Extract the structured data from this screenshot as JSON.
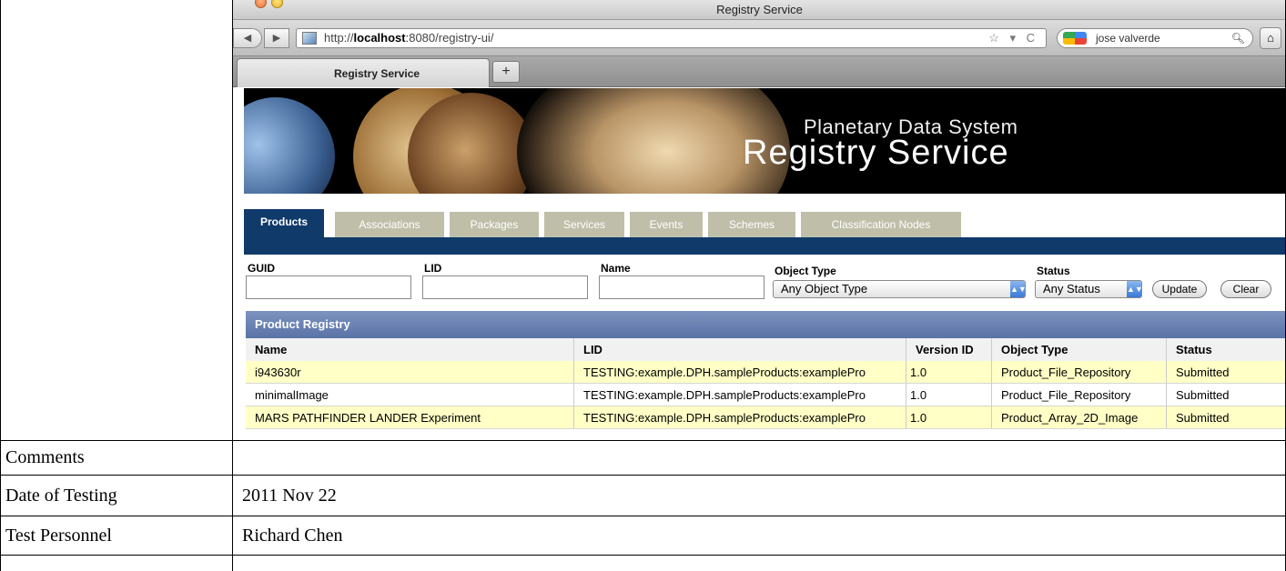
{
  "browser": {
    "window_title": "Registry Service",
    "url_prefix": "http://",
    "url_host": "localhost",
    "url_rest": ":8080/registry-ui/",
    "url_tools": "☆ ▾ C",
    "search_text": "jose valverde",
    "tab_title": "Registry Service",
    "new_tab_label": "+",
    "back_label": "◀",
    "forward_label": "▶"
  },
  "banner": {
    "subtitle": "Planetary Data System",
    "title": "Registry Service"
  },
  "nav_tabs": [
    {
      "label": "Products",
      "active": true
    },
    {
      "label": "Associations",
      "active": false
    },
    {
      "label": "Packages",
      "active": false
    },
    {
      "label": "Services",
      "active": false
    },
    {
      "label": "Events",
      "active": false
    },
    {
      "label": "Schemes",
      "active": false
    },
    {
      "label": "Classification Nodes",
      "active": false
    }
  ],
  "filters": {
    "guid_label": "GUID",
    "lid_label": "LID",
    "name_label": "Name",
    "object_type_label": "Object Type",
    "object_type_value": "Any Object Type",
    "status_label": "Status",
    "status_value": "Any Status",
    "update_label": "Update",
    "clear_label": "Clear"
  },
  "registry": {
    "title": "Product Registry",
    "columns": [
      "Name",
      "LID",
      "Version ID",
      "Object Type",
      "Status"
    ],
    "rows": [
      [
        "i943630r",
        "TESTING:example.DPH.sampleProducts:examplePro",
        "1.0",
        "Product_File_Repository",
        "Submitted"
      ],
      [
        "minimalImage",
        "TESTING:example.DPH.sampleProducts:examplePro",
        "1.0",
        "Product_File_Repository",
        "Submitted"
      ],
      [
        "MARS PATHFINDER LANDER Experiment",
        "TESTING:example.DPH.sampleProducts:examplePro",
        "1.0",
        "Product_Array_2D_Image",
        "Submitted"
      ]
    ],
    "row_highlight_color": "#ffffc6",
    "row_plain_color": "#ffffff"
  },
  "document": {
    "comments_label": "Comments",
    "comments_value": "",
    "date_label": "Date of Testing",
    "date_value": "2011 Nov 22",
    "personnel_label": "Test Personnel",
    "personnel_value": "Richard Chen"
  },
  "colors": {
    "nav_blue": "#0f3a6a",
    "inactive_tab": "#bfbfa9",
    "registry_header": "#6780b2"
  }
}
